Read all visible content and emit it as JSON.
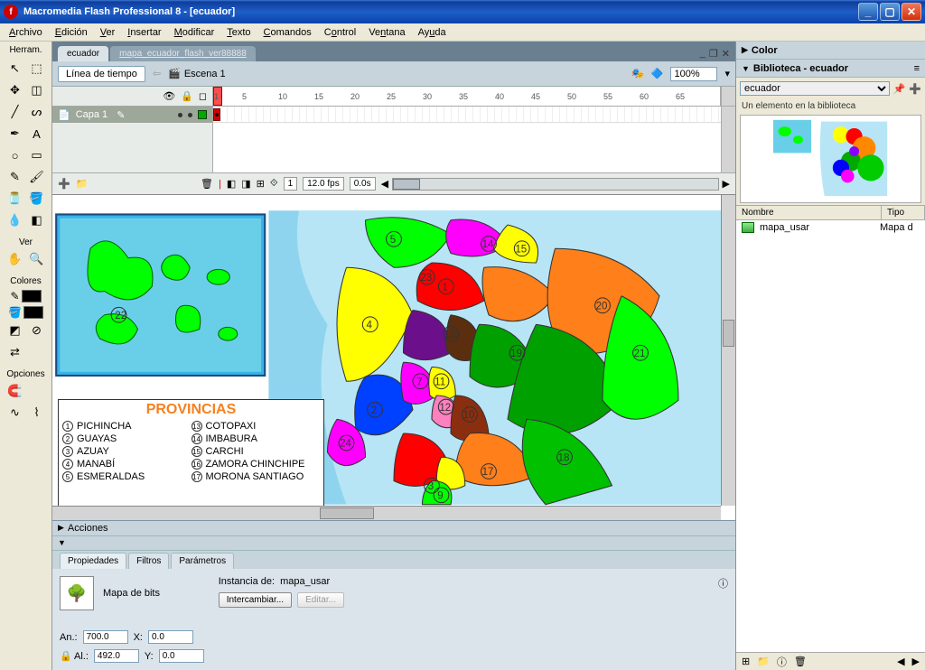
{
  "title": "Macromedia Flash Professional 8 - [ecuador]",
  "menubar": [
    "Archivo",
    "Edición",
    "Ver",
    "Insertar",
    "Modificar",
    "Texto",
    "Comandos",
    "Control",
    "Ventana",
    "Ayuda"
  ],
  "tools_header": "Herram.",
  "tools_ver": "Ver",
  "tools_colores": "Colores",
  "tools_opciones": "Opciones",
  "doc_tabs": {
    "active": "ecuador",
    "inactive": "mapa_ecuador_flash_ver88888"
  },
  "timeline_label": "Línea de tiempo",
  "scene_label": "Escena 1",
  "zoom": "100%",
  "ruler_marks": [
    "1",
    "5",
    "10",
    "15",
    "20",
    "25",
    "30",
    "35",
    "40",
    "45",
    "50",
    "55",
    "60",
    "65"
  ],
  "layer_name": "Capa 1",
  "tl_status": {
    "frame": "1",
    "fps": "12.0 fps",
    "time": "0.0s"
  },
  "actions_label": "Acciones",
  "props_tabs": [
    "Propiedades",
    "Filtros",
    "Parámetros"
  ],
  "props": {
    "type": "Mapa de bits",
    "instance_label": "Instancia de:",
    "instance_name": "mapa_usar",
    "swap_btn": "Intercambiar...",
    "edit_btn": "Editar...",
    "w_label": "An.:",
    "w": "700.0",
    "h_label": "Al.:",
    "h": "492.0",
    "x_label": "X:",
    "x": "0.0",
    "y_label": "Y:",
    "y": "0.0"
  },
  "right": {
    "color_label": "Color",
    "lib_label": "Biblioteca - ecuador",
    "lib_select": "ecuador",
    "lib_info": "Un elemento en la biblioteca",
    "col_name": "Nombre",
    "col_type": "Tipo",
    "item_name": "mapa_usar",
    "item_type": "Mapa d"
  },
  "map": {
    "title": "PROVINCIAS",
    "col1": [
      {
        "n": "1",
        "t": "PICHINCHA"
      },
      {
        "n": "2",
        "t": "GUAYAS"
      },
      {
        "n": "3",
        "t": "AZUAY"
      },
      {
        "n": "4",
        "t": "MANABÍ"
      },
      {
        "n": "5",
        "t": "ESMERALDAS"
      }
    ],
    "col2": [
      {
        "n": "13",
        "t": "COTOPAXI"
      },
      {
        "n": "14",
        "t": "IMBABURA"
      },
      {
        "n": "15",
        "t": "CARCHI"
      },
      {
        "n": "16",
        "t": "ZAMORA CHINCHIPE"
      },
      {
        "n": "17",
        "t": "MORONA SANTIAGO"
      }
    ]
  }
}
